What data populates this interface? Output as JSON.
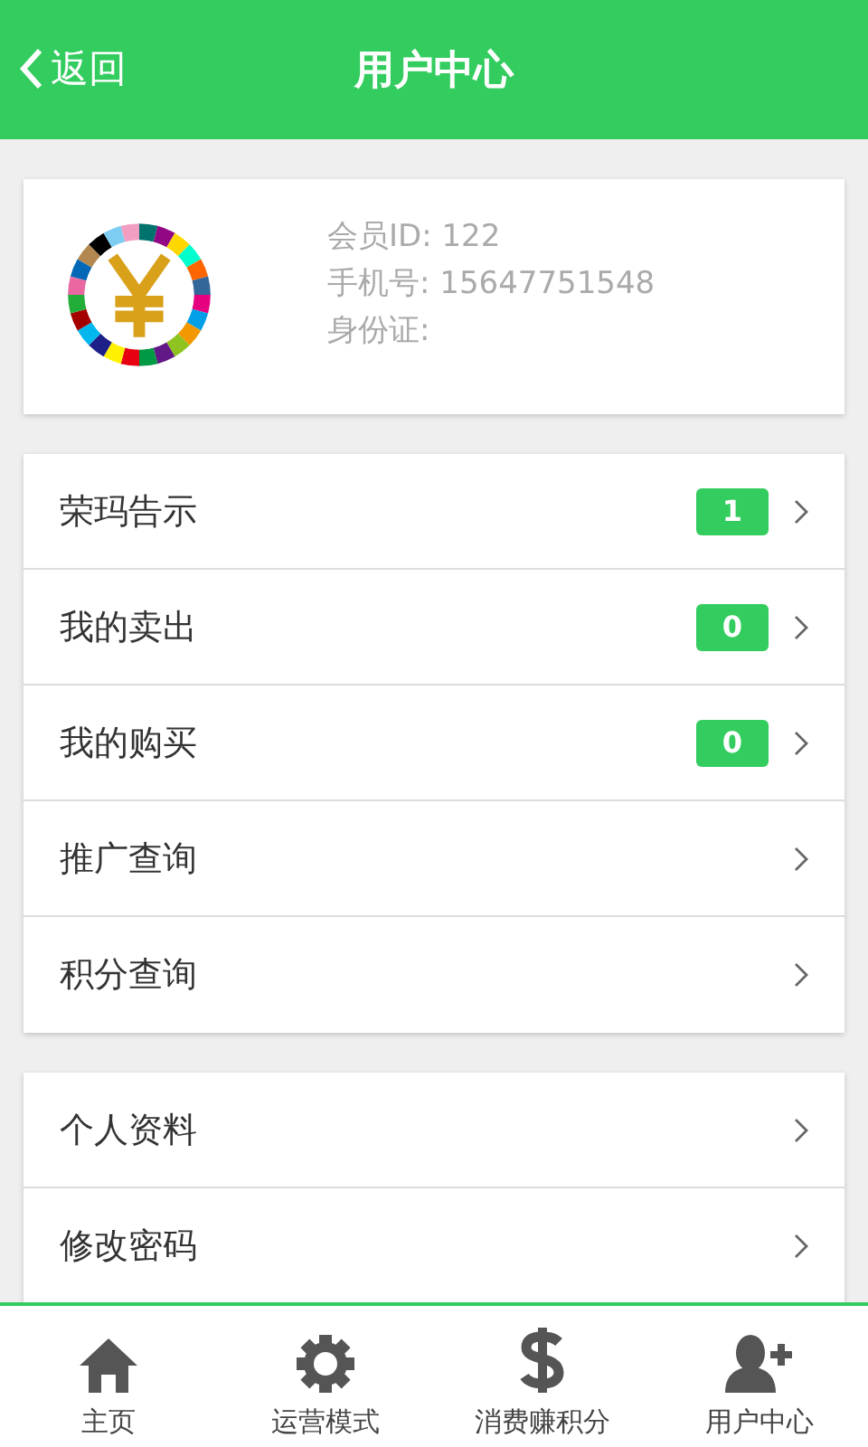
{
  "header": {
    "back_label": "返回",
    "title": "用户中心"
  },
  "profile": {
    "lines": [
      "会员ID: 122",
      "手机号: 15647751548",
      "身份证:"
    ]
  },
  "menu_groups": [
    {
      "items": [
        {
          "label": "荣玛告示",
          "badge": "1"
        },
        {
          "label": "我的卖出",
          "badge": "0"
        },
        {
          "label": "我的购买",
          "badge": "0"
        },
        {
          "label": "推广查询"
        },
        {
          "label": "积分查询"
        }
      ]
    },
    {
      "items": [
        {
          "label": "个人资料"
        },
        {
          "label": "修改密码"
        }
      ]
    }
  ],
  "tab_bar": [
    {
      "kind": "home",
      "label": "主页"
    },
    {
      "kind": "gear",
      "label": "运营模式"
    },
    {
      "kind": "dollar",
      "label": "消费赚积分"
    },
    {
      "kind": "user-add",
      "label": "用户中心"
    }
  ]
}
